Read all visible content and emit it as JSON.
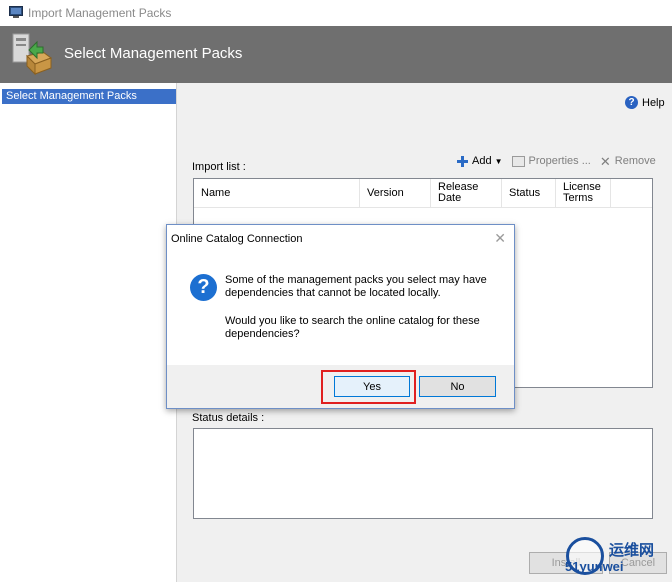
{
  "window": {
    "title": "Import Management Packs",
    "icon": "window-app-icon"
  },
  "banner": {
    "title": "Select Management Packs",
    "icon": "management-pack-icon"
  },
  "nav": {
    "items": [
      {
        "label": "Select Management Packs",
        "selected": true
      }
    ]
  },
  "help": {
    "label": "Help",
    "icon": "help-icon"
  },
  "import_list": {
    "label": "Import list :",
    "toolbar": {
      "add_label": "Add",
      "properties_label": "Properties ...",
      "remove_label": "Remove"
    },
    "columns": [
      "Name",
      "Version",
      "Release Date",
      "Status",
      "License Terms"
    ],
    "rows": []
  },
  "status_details": {
    "label": "Status details :"
  },
  "footer": {
    "install_label": "Install",
    "cancel_label": "Cancel"
  },
  "dialog": {
    "title": "Online Catalog Connection",
    "close_icon": "close-icon",
    "message_line1": "Some of the management packs you select may have dependencies that cannot be located locally.",
    "message_line2": "Would you like to search the online catalog for these dependencies?",
    "yes_label": "Yes",
    "no_label": "No",
    "highlight_color": "#e02020"
  },
  "watermark": {
    "line1": "运维网",
    "line2": "51yunwei"
  }
}
